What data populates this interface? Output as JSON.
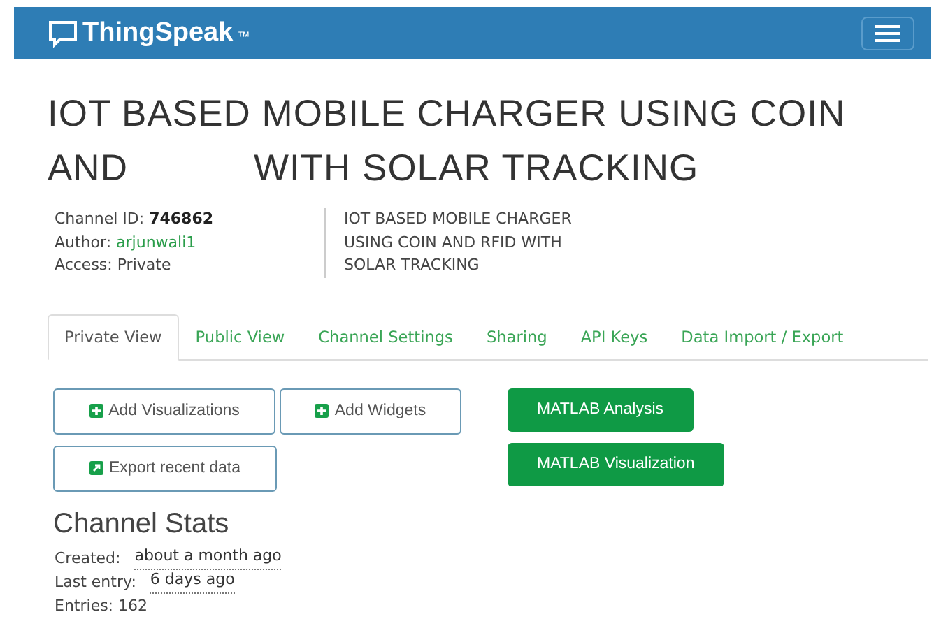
{
  "navbar": {
    "brand": "ThingSpeak",
    "trademark": "™"
  },
  "title": {
    "line_1": "IOT BASED MOBILE CHARGER USING COIN",
    "line_2_start": "AND",
    "line_2_end": "WITH SOLAR TRACKING"
  },
  "channel": {
    "id_label": "Channel ID:",
    "id": "746862",
    "author_label": "Author:",
    "author": "arjunwali1",
    "access": "Access: Private",
    "description": [
      "IOT BASED MOBILE CHARGER",
      "USING COIN AND RFID WITH",
      "SOLAR TRACKING"
    ]
  },
  "tabs": [
    {
      "label": "Private View",
      "selected": true
    },
    {
      "label": "Public View",
      "selected": false
    },
    {
      "label": "Channel Settings",
      "selected": false
    },
    {
      "label": "Sharing",
      "selected": false
    },
    {
      "label": "API Keys",
      "selected": false
    },
    {
      "label": "Data Import / Export",
      "selected": false
    }
  ],
  "left_buttons": [
    {
      "label": "Add Visualizations",
      "kind": "plus"
    },
    {
      "label": "Add Widgets",
      "kind": "plus"
    },
    {
      "label": "Export recent data",
      "kind": "export"
    }
  ],
  "right_buttons": [
    "MATLAB Analysis",
    "MATLAB Visualization"
  ],
  "stats": {
    "heading": "Channel Stats",
    "created_label": "Created:",
    "created": "about a month ago",
    "last_entry_label": "Last entry:",
    "last_entry": "6 days ago",
    "entries": "Entries: 162"
  }
}
